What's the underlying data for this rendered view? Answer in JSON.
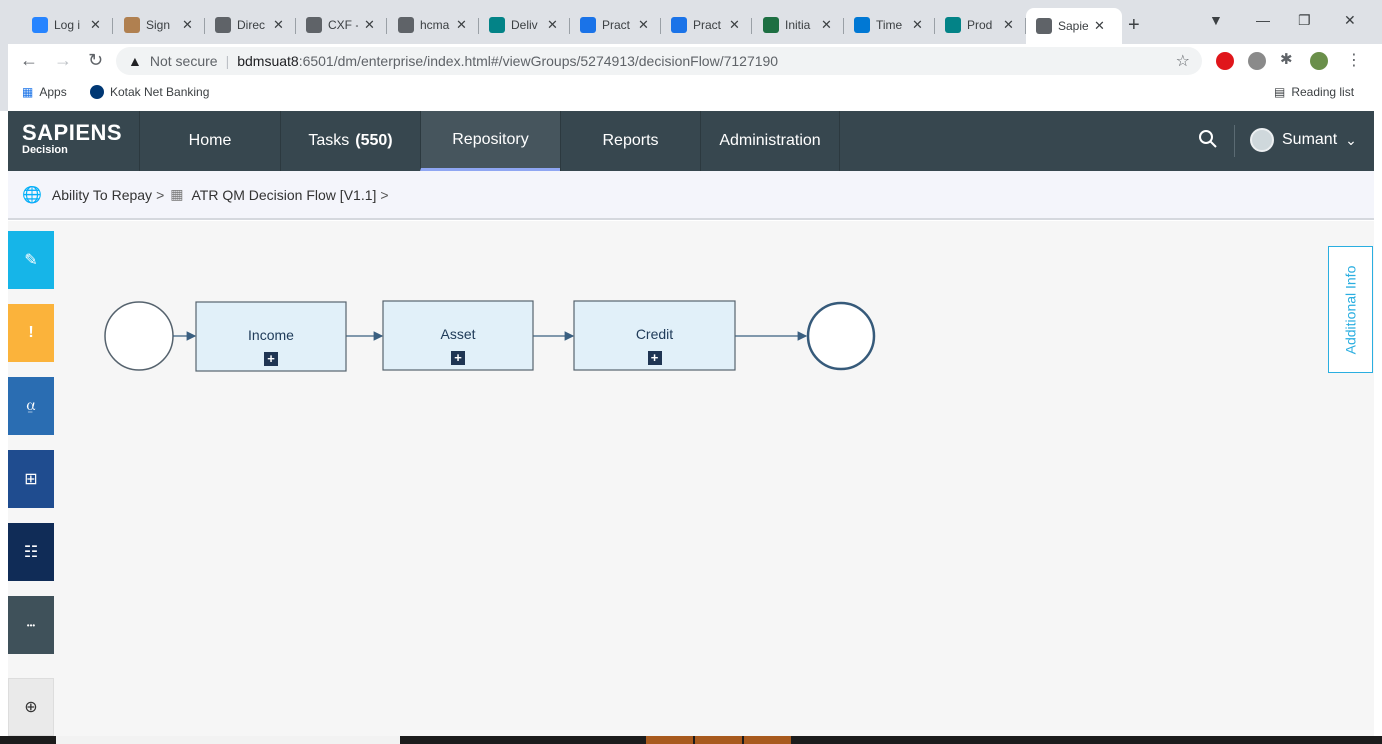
{
  "browser": {
    "tabs": [
      {
        "title": "Log i",
        "icon": "jira-diamond-icon",
        "color": "#2684ff"
      },
      {
        "title": "Sign",
        "icon": "person-icon",
        "color": "#b08050"
      },
      {
        "title": "Direc",
        "icon": "globe-icon",
        "color": "#5f6368"
      },
      {
        "title": "CXF -",
        "icon": "globe-icon",
        "color": "#5f6368"
      },
      {
        "title": "hcma",
        "icon": "x-icon",
        "color": "#5f6368"
      },
      {
        "title": "Deliv",
        "icon": "sharepoint-icon",
        "color": "#038387"
      },
      {
        "title": "Pract",
        "icon": "practice-icon",
        "color": "#1a73e8"
      },
      {
        "title": "Pract",
        "icon": "practice-icon",
        "color": "#1a73e8"
      },
      {
        "title": "Initia",
        "icon": "excel-icon",
        "color": "#1d6f42"
      },
      {
        "title": "Time",
        "icon": "timesheet-icon",
        "color": "#0078d4"
      },
      {
        "title": "Prod",
        "icon": "sharepoint-icon",
        "color": "#038387"
      },
      {
        "title": "Sapie",
        "icon": "globe-icon",
        "color": "#5f6368"
      }
    ],
    "security_label": "Not secure",
    "url_host": "bdmsuat8",
    "url_rest": ":6501/dm/enterprise/index.html#/viewGroups/5274913/decisionFlow/7127190",
    "bookmarks": {
      "apps": "Apps",
      "kotak": "Kotak Net Banking",
      "reading_list": "Reading list"
    }
  },
  "app": {
    "logo_main": "SAPIENS",
    "logo_sub": "Decision",
    "nav": {
      "home": "Home",
      "tasks": "Tasks",
      "tasks_count": "(550)",
      "repository": "Repository",
      "reports": "Reports",
      "administration": "Administration"
    },
    "user_name": "Sumant"
  },
  "breadcrumb": {
    "group": "Ability To Repay",
    "flow": "ATR QM Decision Flow [V1.1]"
  },
  "flow": {
    "steps": [
      "Income",
      "Asset",
      "Credit"
    ],
    "node_fill": "#e1f0f9",
    "node_stroke": "#56636e",
    "edge_color": "#3a5f80"
  },
  "side_tools": [
    {
      "name": "edit-tool",
      "icon": "pencil-icon",
      "color": "#16b5e8"
    },
    {
      "name": "alert-tool",
      "icon": "exclamation-icon",
      "color": "#fbb33b"
    },
    {
      "name": "test-tool",
      "icon": "test-tube-icon",
      "color": "#2a6db2"
    },
    {
      "name": "hierarchy-tool",
      "icon": "hierarchy-icon",
      "color": "#1f4c8f"
    },
    {
      "name": "flow-tool",
      "icon": "flow-icon",
      "color": "#102c57"
    },
    {
      "name": "more-tool",
      "icon": "more-icon",
      "color": "#3f515a"
    }
  ],
  "additional_info_label": "Additional Info"
}
